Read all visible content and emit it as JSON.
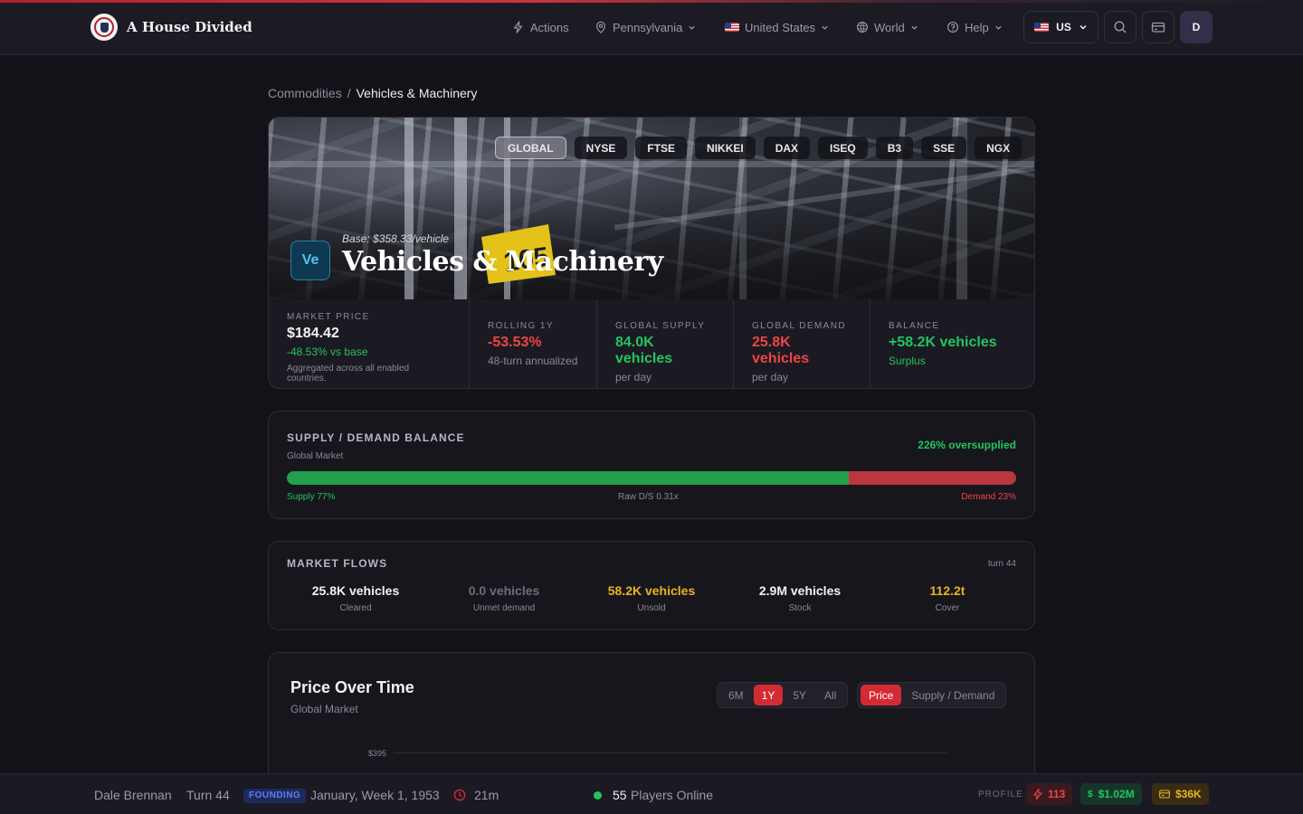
{
  "app": {
    "name": "A House Divided",
    "nav": {
      "actions": "Actions",
      "state": "Pennsylvania",
      "country": "United States",
      "world": "World",
      "help": "Help",
      "locale": "US",
      "avatar_initial": "D"
    }
  },
  "breadcrumb": {
    "parent": "Commodities",
    "separator": "/",
    "current": "Vehicles & Machinery"
  },
  "hero": {
    "exchanges": [
      "GLOBAL",
      "NYSE",
      "FTSE",
      "NIKKEI",
      "DAX",
      "ISEQ",
      "B3",
      "SSE",
      "NGX"
    ],
    "active_exchange": "GLOBAL",
    "badge": "Ve",
    "base_price": "Base: $358.33/vehicle",
    "title": "Vehicles & Machinery",
    "sign_text": "105"
  },
  "stats": {
    "market_price": {
      "label": "MARKET PRICE",
      "value": "$184.42",
      "change": "-48.53% vs base",
      "note": "Aggregated across all enabled countries."
    },
    "rolling": {
      "label": "ROLLING 1Y",
      "value": "-53.53%",
      "sub": "48-turn annualized"
    },
    "supply": {
      "label": "GLOBAL SUPPLY",
      "value": "84.0K vehicles",
      "sub": "per day"
    },
    "demand": {
      "label": "GLOBAL DEMAND",
      "value": "25.8K vehicles",
      "sub": "per day"
    },
    "balance": {
      "label": "BALANCE",
      "value": "+58.2K vehicles",
      "sub": "Surplus"
    }
  },
  "supply_demand": {
    "title": "SUPPLY / DEMAND BALANCE",
    "subtitle": "Global Market",
    "status": "226% oversupplied",
    "supply_share": 0.77,
    "supply_label": "Supply 77%",
    "raw_label": "Raw D/S 0.31x",
    "demand_label": "Demand 23%"
  },
  "flows": {
    "title": "MARKET FLOWS",
    "turn": "turn 44",
    "items": [
      {
        "value": "25.8K vehicles",
        "label": "Cleared",
        "color": "#f2f2f4"
      },
      {
        "value": "0.0 vehicles",
        "label": "Unmet demand",
        "color": "#6e6c7a"
      },
      {
        "value": "58.2K vehicles",
        "label": "Unsold",
        "color": "#e6b422"
      },
      {
        "value": "2.9M vehicles",
        "label": "Stock",
        "color": "#f2f2f4"
      },
      {
        "value": "112.2t",
        "label": "Cover",
        "color": "#e6b422"
      }
    ]
  },
  "price_over_time": {
    "title": "Price Over Time",
    "subtitle": "Global Market",
    "ranges": [
      "6M",
      "1Y",
      "5Y",
      "All"
    ],
    "active_range": "1Y",
    "modes": [
      "Price",
      "Supply / Demand"
    ],
    "active_mode": "Price",
    "y_tick_top": "$395"
  },
  "footer": {
    "player": "Dale Brennan",
    "turn": "Turn 44",
    "tag": "FOUNDING",
    "date": "January, Week 1, 1953",
    "timer": "21m",
    "online_count": "55",
    "online_label": "Players Online",
    "profile": "PROFILE",
    "energy": "113",
    "cash": "$1.02M",
    "wallet": "$36K"
  },
  "colors": {
    "accent_red": "#d42a33",
    "green": "#22c55e",
    "red": "#ef4444",
    "amber": "#e6b422"
  }
}
